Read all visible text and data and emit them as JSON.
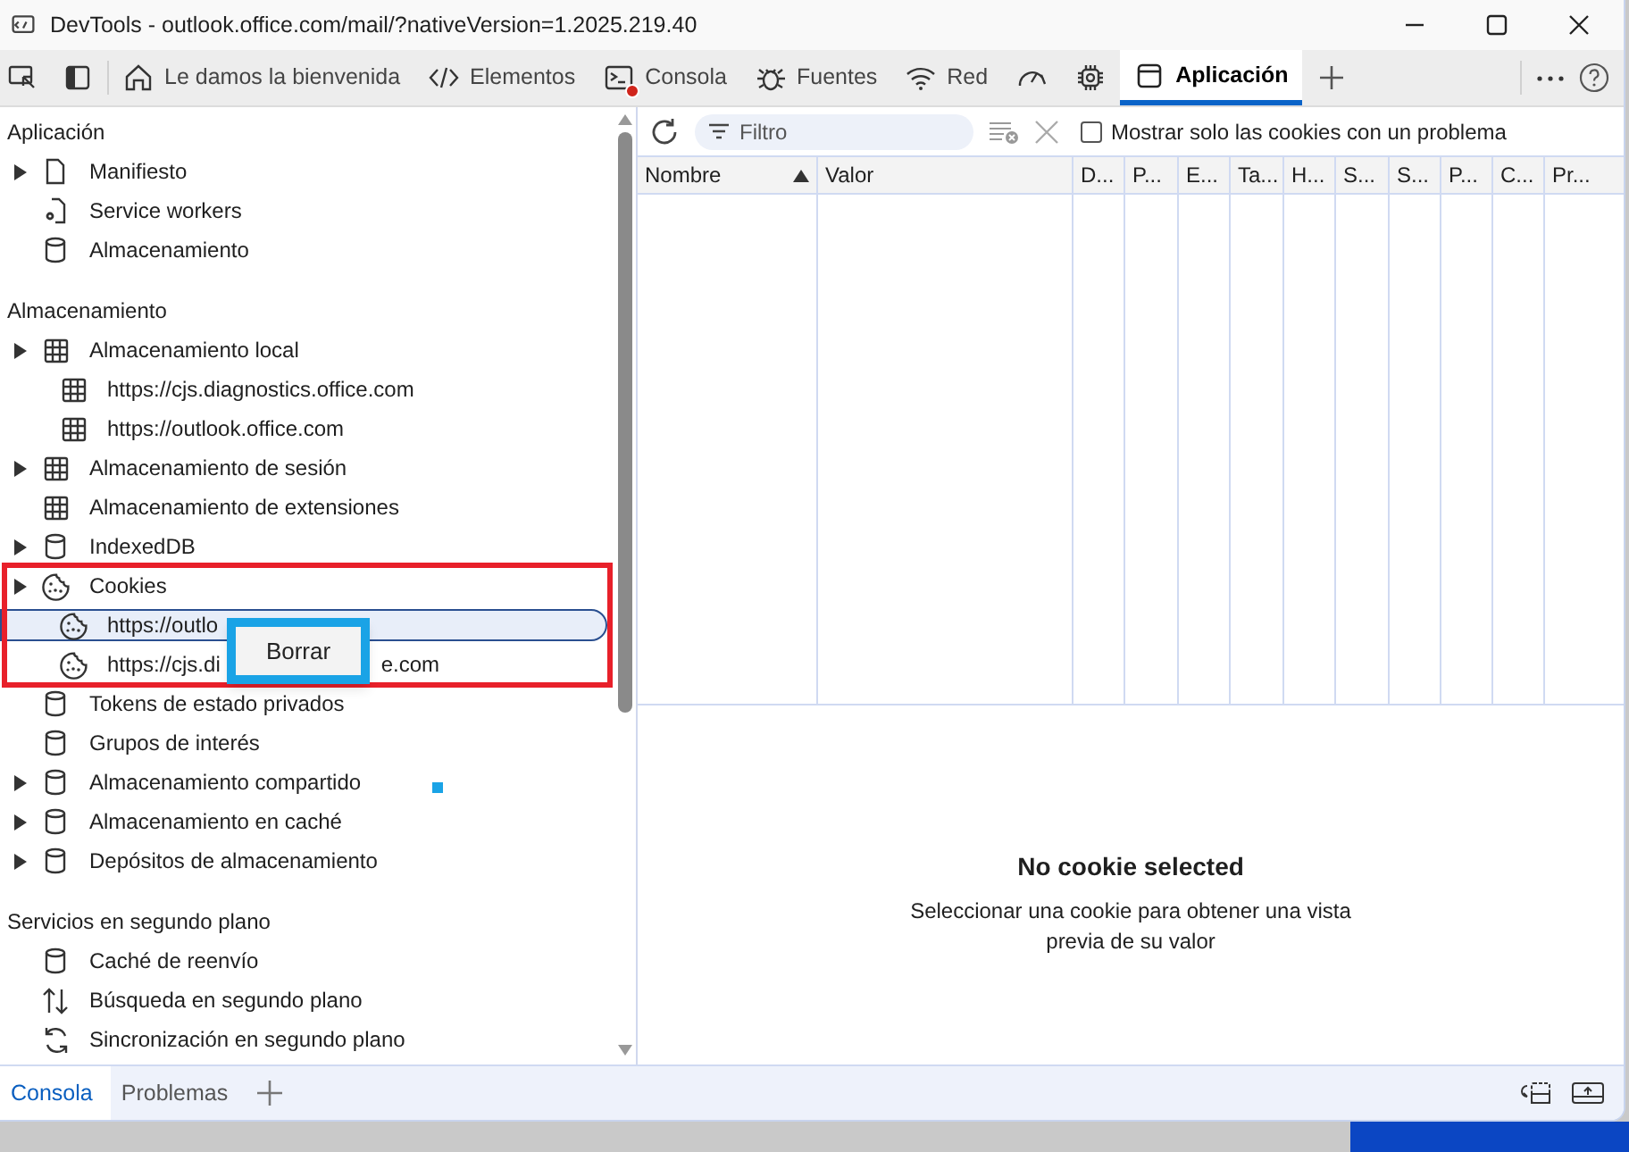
{
  "window": {
    "title": "DevTools - outlook.office.com/mail/?nativeVersion=1.2025.219.40"
  },
  "tabs": [
    {
      "kind": "inspect"
    },
    {
      "kind": "dock"
    },
    {
      "kind": "home",
      "label": "Le damos la bienvenida",
      "selected": false
    },
    {
      "kind": "code",
      "label": "Elementos",
      "selected": false
    },
    {
      "kind": "console",
      "label": "Consola",
      "selected": false,
      "error_badge": true
    },
    {
      "kind": "bug",
      "label": "Fuentes",
      "selected": false
    },
    {
      "kind": "wifi",
      "label": "Red",
      "selected": false
    },
    {
      "kind": "gauge",
      "selected": false
    },
    {
      "kind": "chip",
      "selected": false
    },
    {
      "kind": "app",
      "label": "Aplicación",
      "selected": true
    },
    {
      "kind": "plus"
    }
  ],
  "sidebar": {
    "sections": [
      {
        "title": "Aplicación",
        "items": [
          {
            "kind": "doc",
            "label": "Manifiesto",
            "expanded": false,
            "selected": false
          },
          {
            "kind": "gear-doc",
            "label": "Service workers",
            "selected": false
          },
          {
            "kind": "db",
            "label": "Almacenamiento",
            "selected": false
          }
        ]
      },
      {
        "title": "Almacenamiento",
        "items": [
          {
            "kind": "grid",
            "label": "Almacenamiento local",
            "expanded": false,
            "selected": false,
            "children": [
              {
                "kind": "grid",
                "label": "https://cjs.diagnostics.office.com",
                "selected": false
              },
              {
                "kind": "grid",
                "label": "https://outlook.office.com",
                "selected": false
              }
            ]
          },
          {
            "kind": "grid",
            "label": "Almacenamiento de sesión",
            "expanded": false,
            "selected": false
          },
          {
            "kind": "grid",
            "label": "Almacenamiento de extensiones",
            "selected": false
          },
          {
            "kind": "db",
            "label": "IndexedDB",
            "expanded": false,
            "selected": false
          },
          {
            "kind": "cookie",
            "label": "Cookies",
            "expanded": false,
            "selected": false,
            "children": [
              {
                "kind": "cookie",
                "label": "https://outlo",
                "selected": true
              },
              {
                "kind": "cookie",
                "label": "https://cjs.di",
                "label_end": "e.com",
                "selected": false
              }
            ]
          },
          {
            "kind": "db",
            "label": "Tokens de estado privados",
            "selected": false
          },
          {
            "kind": "db",
            "label": "Grupos de interés",
            "selected": false
          },
          {
            "kind": "db",
            "label": "Almacenamiento compartido",
            "expanded": false,
            "selected": false
          },
          {
            "kind": "db",
            "label": "Almacenamiento en caché",
            "expanded": false,
            "selected": false
          },
          {
            "kind": "db",
            "label": "Depósitos de almacenamiento",
            "expanded": false,
            "selected": false
          }
        ]
      },
      {
        "title": "Servicios en segundo plano",
        "items": [
          {
            "kind": "db",
            "label": "Caché de reenvío",
            "selected": false
          },
          {
            "kind": "updown",
            "label": "Búsqueda en segundo plano",
            "selected": false
          },
          {
            "kind": "sync",
            "label": "Sincronización en segundo plano",
            "selected": false
          }
        ]
      }
    ]
  },
  "context_menu": {
    "items": [
      "Borrar"
    ]
  },
  "toolbar": {
    "filter_placeholder": "Filtro",
    "checkbox": {
      "label": "Mostrar solo las cookies con un problema",
      "checked": false
    }
  },
  "table": {
    "columns": [
      {
        "label": "Nombre",
        "sort_ascending": true
      },
      {
        "label": "Valor"
      },
      {
        "label": "D..."
      },
      {
        "label": "P..."
      },
      {
        "label": "E..."
      },
      {
        "label": "Ta..."
      },
      {
        "label": "H..."
      },
      {
        "label": "S..."
      },
      {
        "label": "S..."
      },
      {
        "label": "P..."
      },
      {
        "label": "C..."
      },
      {
        "label": "Pr..."
      }
    ]
  },
  "preview": {
    "title": "No cookie selected",
    "message": "Seleccionar una cookie para obtener una vista previa de su valor"
  },
  "drawer": {
    "tabs": [
      {
        "label": "Consola",
        "selected": true
      },
      {
        "label": "Problemas",
        "selected": false
      }
    ]
  }
}
